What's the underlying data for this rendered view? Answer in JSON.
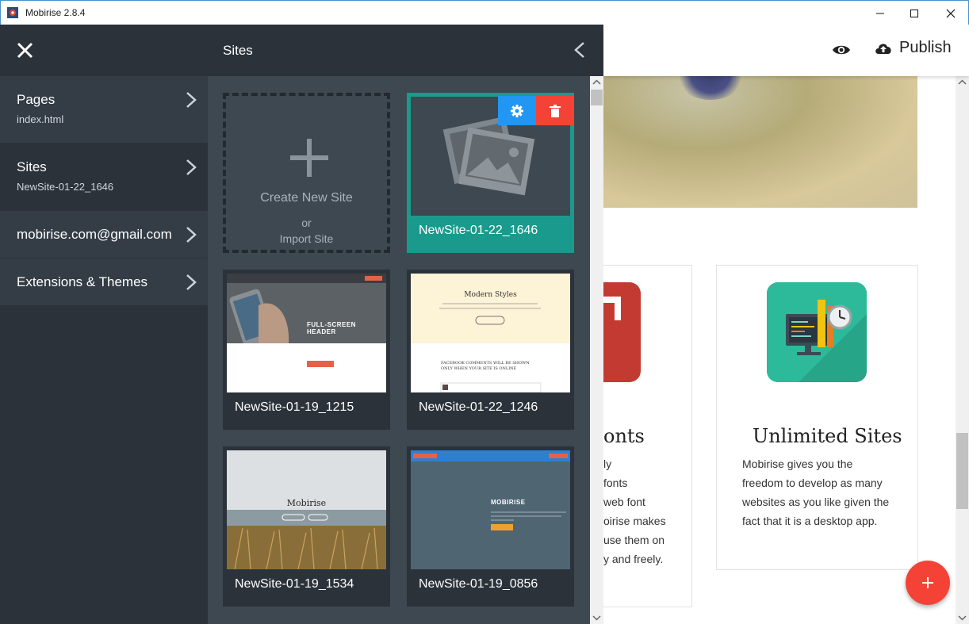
{
  "window": {
    "title": "Mobirise 2.8.4"
  },
  "editor": {
    "publish_label": "Publish",
    "features": [
      {
        "title": "onts",
        "lines": [
          "ly",
          "fonts",
          "web font",
          "oirise makes",
          "use them on",
          "y and freely."
        ]
      },
      {
        "title": "Unlimited Sites",
        "lines": [
          "Mobirise gives you the",
          "freedom to develop as many",
          "websites as you like given the",
          "fact that it is a desktop app."
        ]
      }
    ]
  },
  "menu": {
    "items": [
      {
        "title": "Pages",
        "sub": "index.html"
      },
      {
        "title": "Sites",
        "sub": "NewSite-01-22_1646"
      },
      {
        "title": "mobirise.com@gmail.com"
      },
      {
        "title": "Extensions & Themes"
      }
    ]
  },
  "sites": {
    "title": "Sites",
    "new_site": {
      "create": "Create New Site",
      "or": "or",
      "import": "Import Site"
    },
    "list": [
      {
        "name": "NewSite-01-22_1646",
        "active": true
      },
      {
        "name": "NewSite-01-19_1215"
      },
      {
        "name": "NewSite-01-22_1246"
      },
      {
        "name": "NewSite-01-19_1534"
      },
      {
        "name": "NewSite-01-19_0856"
      }
    ],
    "thumbs": {
      "fs_header": "FULL-SCREEN HEADER",
      "modern_styles": "Modern Styles",
      "fb_comments": "FACEBOOK COMMENTS WILL BE SHOWN ONLY WHEN YOUR SITE IS ONLINE",
      "mobirise_caption": "Mobirise",
      "mobirise_caps": "MOBIRISE"
    }
  },
  "colors": {
    "accent": "#1a9a8c",
    "menu_bg": "#2b323a",
    "panel_bg": "#3d4851",
    "danger": "#f44336",
    "info": "#2196f3"
  }
}
